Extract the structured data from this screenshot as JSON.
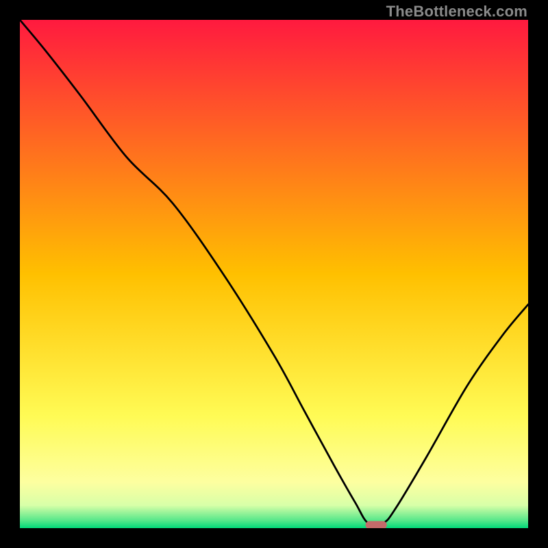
{
  "watermark": "TheBottleneck.com",
  "chart_data": {
    "type": "line",
    "title": "",
    "xlabel": "",
    "ylabel": "",
    "xlim": [
      0,
      100
    ],
    "ylim": [
      0,
      100
    ],
    "grid": false,
    "legend": false,
    "background_gradient": [
      {
        "pos": 0.0,
        "color": "#ff1a3f"
      },
      {
        "pos": 0.5,
        "color": "#ffc000"
      },
      {
        "pos": 0.78,
        "color": "#fffb55"
      },
      {
        "pos": 0.91,
        "color": "#fdffa0"
      },
      {
        "pos": 0.955,
        "color": "#d8ffa8"
      },
      {
        "pos": 0.985,
        "color": "#56e78a"
      },
      {
        "pos": 1.0,
        "color": "#00d878"
      }
    ],
    "series": [
      {
        "name": "bottleneck-curve",
        "color": "#000000",
        "x": [
          0.0,
          5.0,
          12.0,
          21.0,
          30.0,
          40.0,
          50.0,
          56.0,
          62.0,
          66.0,
          68.5,
          71.5,
          74.0,
          80.0,
          88.0,
          95.0,
          100.0
        ],
        "y": [
          100.0,
          94.0,
          85.0,
          73.0,
          64.0,
          50.0,
          34.0,
          23.0,
          12.0,
          5.0,
          1.0,
          1.0,
          4.0,
          14.0,
          28.0,
          38.0,
          44.0
        ]
      }
    ],
    "marker": {
      "name": "optimal-zone",
      "color": "#c46a6a",
      "x": 70.1,
      "y": 0.6,
      "width": 4.2,
      "height": 1.6
    }
  }
}
